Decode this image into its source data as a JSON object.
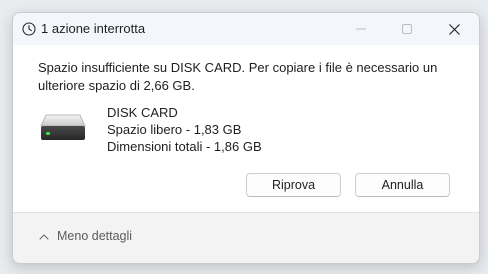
{
  "window": {
    "title": "1 azione interrotta",
    "icon": "clock-icon"
  },
  "titlebar_buttons": {
    "minimize": "minimize-icon",
    "maximize": "maximize-icon",
    "close": "close-icon"
  },
  "message": {
    "text": "Spazio insufficiente su DISK CARD. Per copiare i file è necessario un ulteriore spazio di 2,66 GB."
  },
  "disk": {
    "icon": "hard-drive-icon",
    "name": "DISK CARD",
    "free_space": "Spazio libero - 1,83 GB",
    "total_size": "Dimensioni totali - 1,86 GB"
  },
  "buttons": {
    "retry": "Riprova",
    "cancel": "Annulla"
  },
  "footer": {
    "details_label": "Meno dettagli",
    "details_icon": "chevron-up-icon"
  },
  "colors": {
    "titlebar_bg": "#f3f6fb",
    "footer_bg": "#f3f3f3",
    "disk_led": "#3ddc3d"
  }
}
